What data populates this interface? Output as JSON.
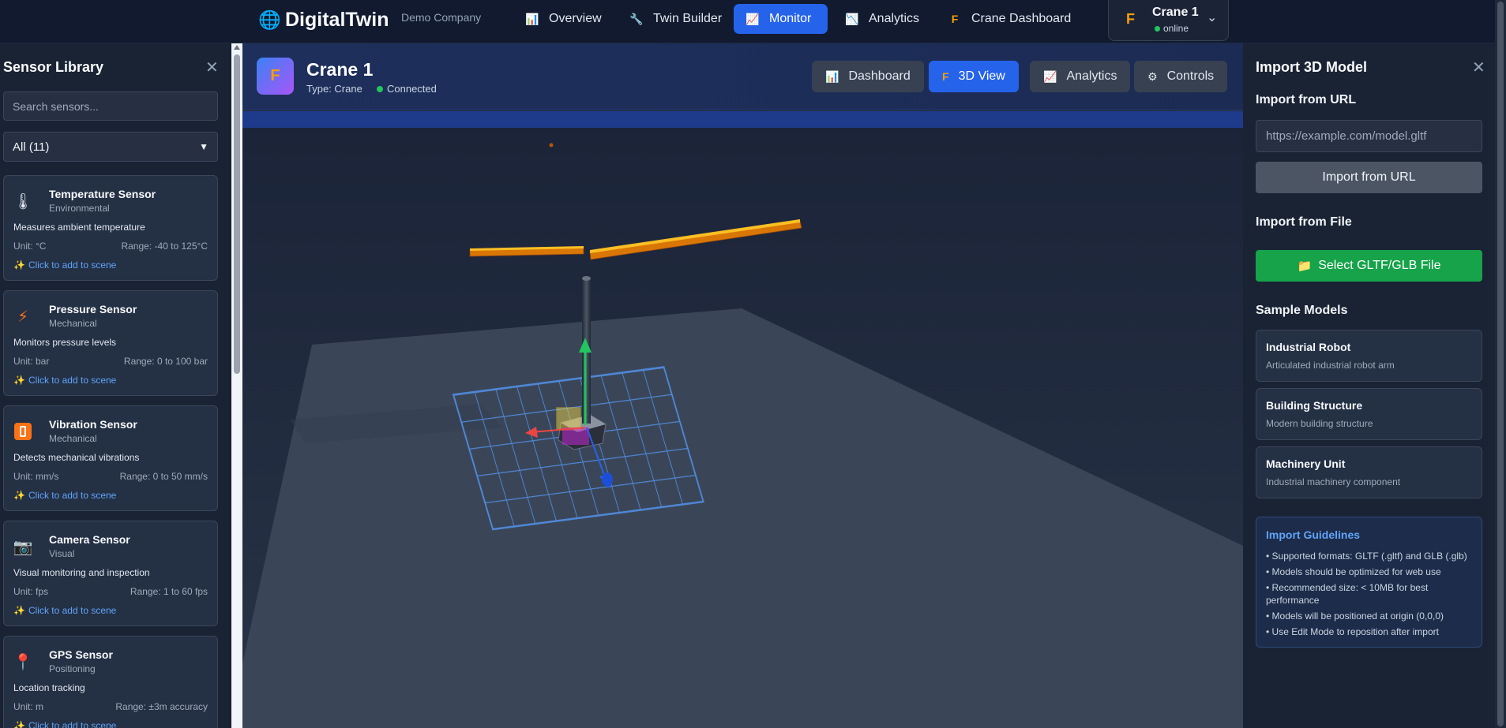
{
  "topbar": {
    "brand": "DigitalTwin",
    "brand_icon": "globe-icon",
    "company": "Demo Company",
    "nav": [
      {
        "label": "Overview",
        "icon": "bar-chart-icon"
      },
      {
        "label": "Twin Builder",
        "icon": "wrench-icon"
      },
      {
        "label": "Monitor",
        "icon": "line-chart-icon",
        "active": true
      },
      {
        "label": "Analytics",
        "icon": "trend-chart-icon"
      },
      {
        "label": "Crane Dashboard",
        "icon": "crane-icon"
      }
    ],
    "twin_selector": {
      "name": "Crane 1",
      "status": "online",
      "icon": "crane-icon"
    }
  },
  "sensor_library": {
    "title": "Sensor Library",
    "search_placeholder": "Search sensors...",
    "filter_value": "All (11)",
    "add_text": "Click to add to scene",
    "sensors": [
      {
        "name": "Temperature Sensor",
        "category": "Environmental",
        "description": "Measures ambient temperature",
        "unit": "Unit: °C",
        "range": "Range: -40 to 125°C",
        "icon": "thermometer-icon"
      },
      {
        "name": "Pressure Sensor",
        "category": "Mechanical",
        "description": "Monitors pressure levels",
        "unit": "Unit: bar",
        "range": "Range: 0 to 100 bar",
        "icon": "lightning-icon"
      },
      {
        "name": "Vibration Sensor",
        "category": "Mechanical",
        "description": "Detects mechanical vibrations",
        "unit": "Unit: mm/s",
        "range": "Range: 0 to 50 mm/s",
        "icon": "vibration-icon"
      },
      {
        "name": "Camera Sensor",
        "category": "Visual",
        "description": "Visual monitoring and inspection",
        "unit": "Unit: fps",
        "range": "Range: 1 to 60 fps",
        "icon": "camera-icon"
      },
      {
        "name": "GPS Sensor",
        "category": "Positioning",
        "description": "Location tracking",
        "unit": "Unit: m",
        "range": "Range: ±3m accuracy",
        "icon": "pin-icon"
      }
    ]
  },
  "twin_header": {
    "title": "Crane 1",
    "type": "Type: Crane",
    "connection": "Connected",
    "views": [
      {
        "label": "Dashboard",
        "icon": "bar-chart-icon"
      },
      {
        "label": "3D View",
        "icon": "crane-icon",
        "active": true
      },
      {
        "label": "Analytics",
        "icon": "line-chart-icon"
      },
      {
        "label": "Controls",
        "icon": "gear-icon"
      }
    ]
  },
  "import_panel": {
    "title": "Import 3D Model",
    "url_section": "Import from URL",
    "url_placeholder": "https://example.com/model.gltf",
    "url_button": "Import from URL",
    "file_section": "Import from File",
    "file_button": "Select GLTF/GLB File",
    "samples_section": "Sample Models",
    "samples": [
      {
        "name": "Industrial Robot",
        "description": "Articulated industrial robot arm"
      },
      {
        "name": "Building Structure",
        "description": "Modern building structure"
      },
      {
        "name": "Machinery Unit",
        "description": "Industrial machinery component"
      }
    ],
    "guidelines_title": "Import Guidelines",
    "guidelines": [
      "• Supported formats: GLTF (.gltf) and GLB (.glb)",
      "• Models should be optimized for web use",
      "• Recommended size: < 10MB for best performance",
      "• Models will be positioned at origin (0,0,0)",
      "• Use Edit Mode to reposition after import"
    ]
  },
  "colors": {
    "accent": "#2563eb",
    "success": "#16a34a",
    "boom": "#d97706",
    "grid": "#3b82f6"
  }
}
